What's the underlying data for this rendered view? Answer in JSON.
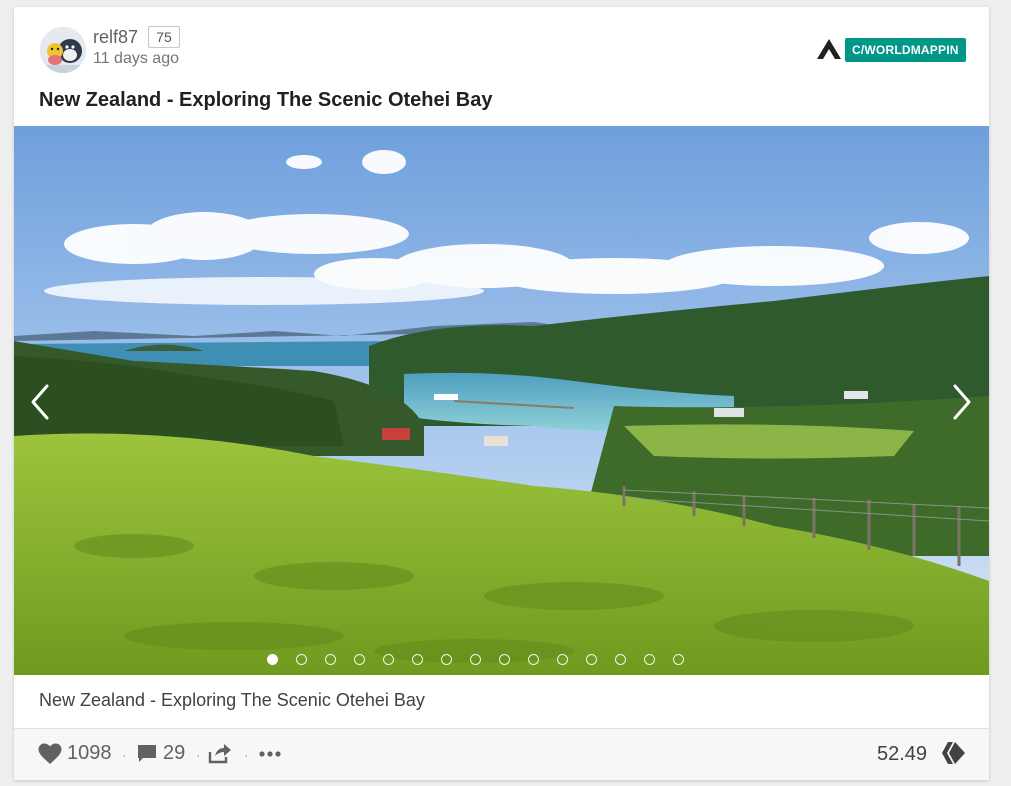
{
  "post": {
    "author": "relf87",
    "reputation": "75",
    "time_ago": "11 days ago",
    "community": "C/WORLDMAPPIN",
    "title": "New Zealand - Exploring The Scenic Otehei Bay",
    "caption": "New Zealand - Exploring The Scenic Otehei Bay"
  },
  "carousel": {
    "slide_count": 15,
    "active_index": 0
  },
  "footer": {
    "likes": "1098",
    "comments": "29",
    "payout": "52.49"
  },
  "colors": {
    "accent": "#009688",
    "text": "#212121",
    "muted": "#616161"
  },
  "icons": {
    "like": "heart-icon",
    "comments": "comment-icon",
    "share": "share-icon",
    "more": "more-icon",
    "currency": "hive-icon",
    "prev": "chevron-left-icon",
    "next": "chevron-right-icon"
  }
}
